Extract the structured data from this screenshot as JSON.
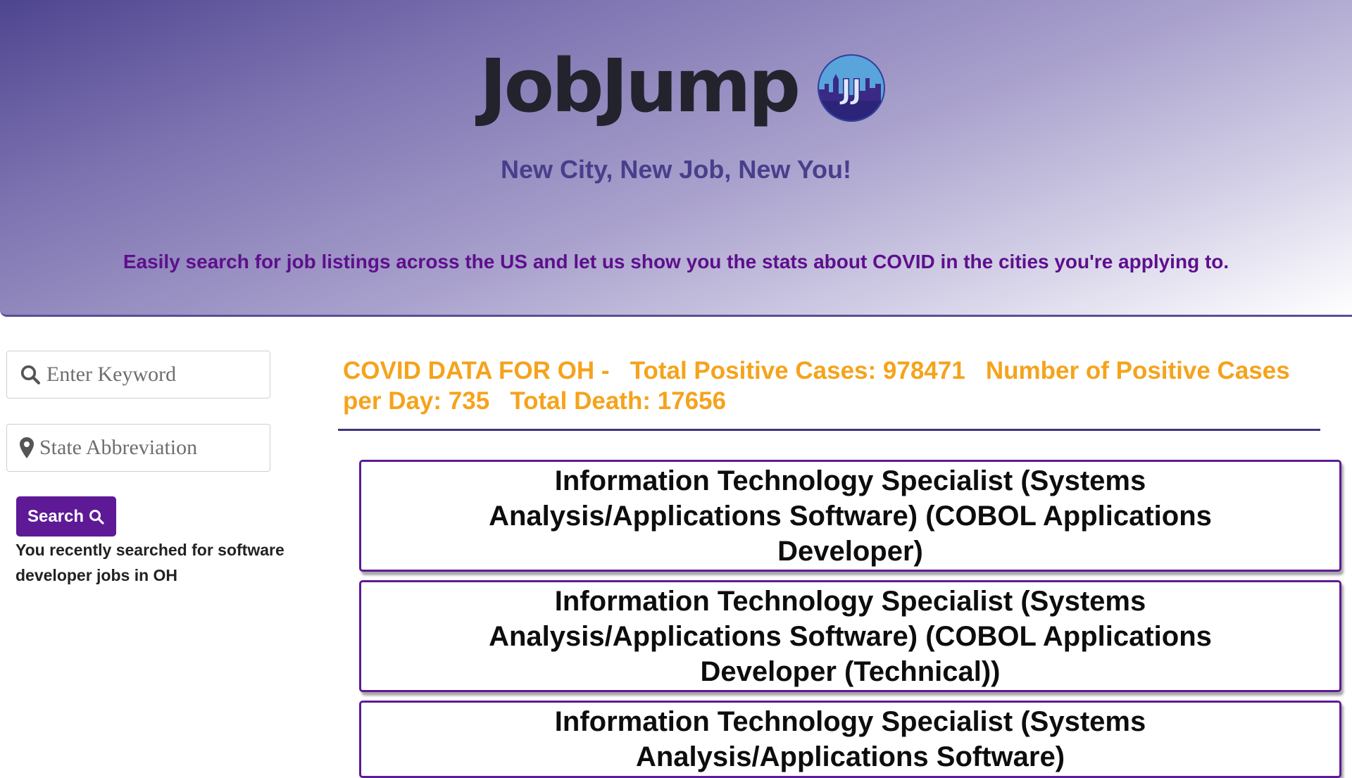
{
  "header": {
    "brand": "JobJump",
    "logo_text": "JJ",
    "tagline": "New City, New Job, New You!",
    "blurb": "Easily search for job listings across the US and let us show you the stats about COVID in the cities you're applying to."
  },
  "search": {
    "keyword_placeholder": "Enter Keyword",
    "state_placeholder": "State Abbreviation",
    "button_label": "Search",
    "recent_text": "You recently searched for software developer jobs in OH"
  },
  "covid": {
    "heading": "COVID DATA FOR OH -",
    "total_cases": "Total Positive Cases: 978471",
    "cases_per_day": "Number of Positive Cases per Day: 735",
    "total_death": "Total Death: 17656"
  },
  "jobs": [
    {
      "title": "Information Technology Specialist (Systems Analysis/Applications Software) (COBOL Applications Developer)"
    },
    {
      "title": "Information Technology Specialist (Systems Analysis/Applications Software) (COBOL Applications Developer (Technical))"
    },
    {
      "title": "Information Technology Specialist (Systems Analysis/Applications Software)"
    }
  ],
  "colors": {
    "brand_purple": "#5e1a96",
    "covid_orange": "#f5a31c",
    "tagline_indigo": "#483f8c",
    "hero_gradient_start": "#4e4590"
  },
  "icons": {
    "keyword_field": "search-icon",
    "state_field": "map-marker-icon",
    "button": "search-icon"
  }
}
